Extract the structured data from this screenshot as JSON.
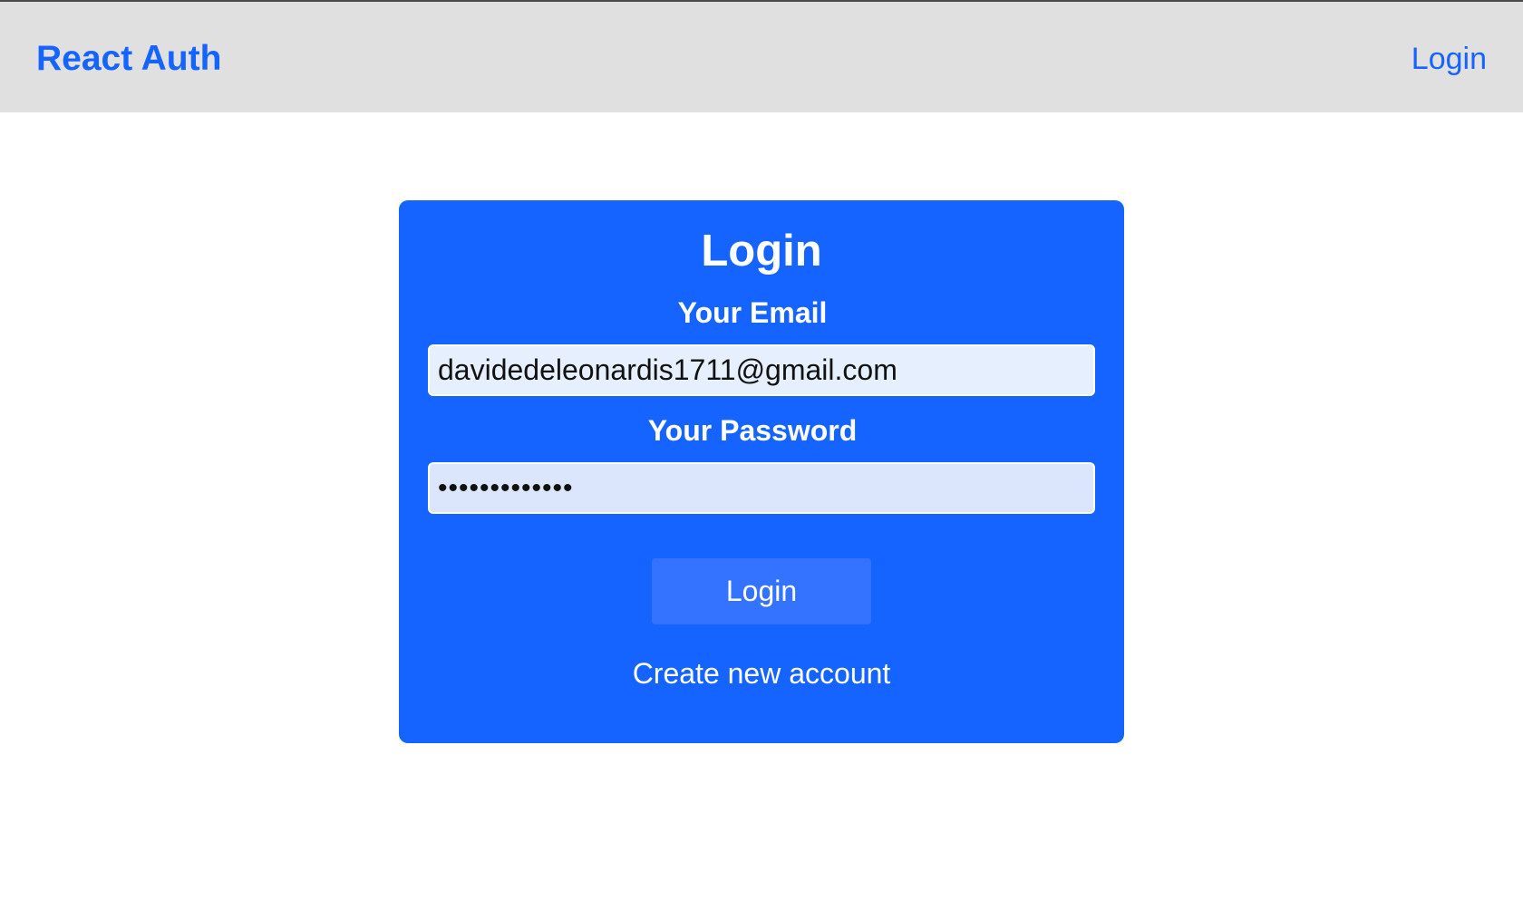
{
  "header": {
    "brand": "React Auth",
    "nav_login": "Login"
  },
  "auth_form": {
    "title": "Login",
    "email_label": "Your Email",
    "email_value": "davidedeleonardis1711@gmail.com",
    "password_label": "Your Password",
    "password_masked": "•••••••••••••",
    "submit_label": "Login",
    "toggle_label": "Create new account"
  },
  "colors": {
    "accent": "#1664ff",
    "header_bg": "#e0e0e0",
    "button_bg": "#3473ff"
  }
}
